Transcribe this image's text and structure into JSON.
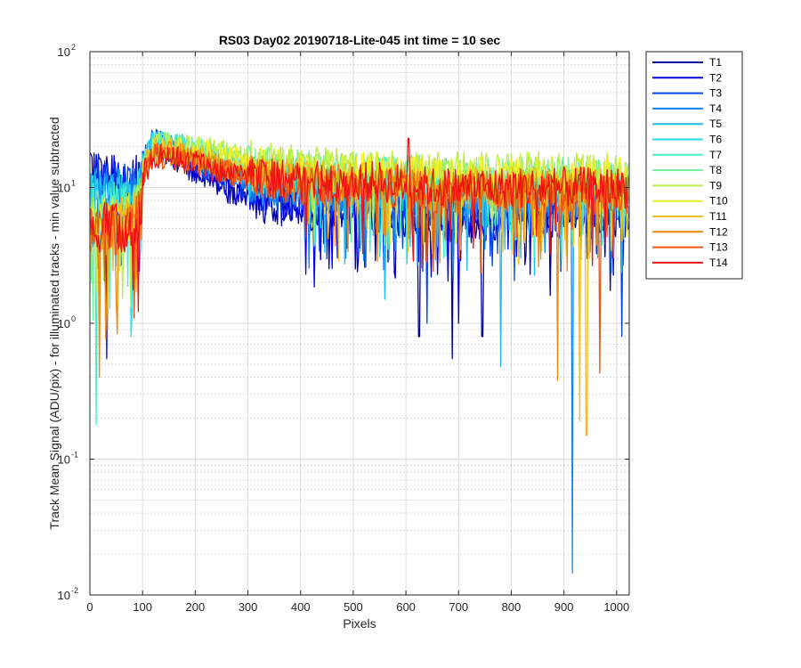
{
  "chart_data": {
    "type": "line",
    "title": "RS03 Day02 20190718-Lite-045 int time = 10 sec",
    "xlabel": "Pixels",
    "ylabel": "Track Mean Signal (ADU/pix) - for illuminated tracks - min value subtracted",
    "xscale": "linear",
    "yscale": "log",
    "xlim": [
      0,
      1024
    ],
    "ylim": [
      0.01,
      100
    ],
    "xticks": [
      0,
      100,
      200,
      300,
      400,
      500,
      600,
      700,
      800,
      900,
      1000
    ],
    "xtick_labels": [
      "0",
      "100",
      "200",
      "300",
      "400",
      "500",
      "600",
      "700",
      "800",
      "900",
      "1000"
    ],
    "ytick_labels": [
      {
        "base": "10",
        "exp": "-2"
      },
      {
        "base": "10",
        "exp": "-1"
      },
      {
        "base": "10",
        "exp": "0"
      },
      {
        "base": "10",
        "exp": "1"
      },
      {
        "base": "10",
        "exp": "2"
      }
    ],
    "grid": "major and minor",
    "legend_position": "outside-right",
    "series": [
      {
        "name": "T1",
        "color": "#0000aa",
        "x": [
          0,
          25,
          50,
          75,
          99,
          100,
          120,
          150,
          200,
          250,
          300,
          350,
          400,
          450,
          500,
          550,
          600,
          650,
          700,
          750,
          800,
          850,
          900,
          950,
          1000,
          1023
        ],
        "y": [
          13,
          12,
          11,
          10,
          12,
          16,
          20,
          18,
          13,
          10,
          8,
          7.5,
          7,
          6.5,
          6.5,
          6.5,
          6,
          5.5,
          5.5,
          5.5,
          6,
          6,
          6,
          6,
          6,
          6
        ],
        "dips": [
          [
            625,
            0.8
          ],
          [
            688,
            0.55
          ],
          [
            745,
            0.8
          ]
        ]
      },
      {
        "name": "T2",
        "color": "#0000dd",
        "x": [
          0,
          25,
          50,
          75,
          99,
          100,
          120,
          150,
          200,
          250,
          300,
          350,
          400,
          450,
          500,
          550,
          600,
          650,
          700,
          750,
          800,
          850,
          900,
          950,
          1000,
          1023
        ],
        "y": [
          12,
          11.5,
          11,
          10,
          12,
          16,
          21,
          19,
          14,
          11,
          9,
          8,
          7.5,
          7,
          7,
          7,
          6.5,
          6,
          6,
          6,
          6.5,
          6.5,
          6.5,
          6.5,
          6.5,
          6.5
        ],
        "dips": [
          [
            32,
            0.55
          ],
          [
            700,
            1.0
          ]
        ]
      },
      {
        "name": "T3",
        "color": "#0044ee",
        "x": [
          0,
          25,
          50,
          75,
          99,
          100,
          120,
          150,
          200,
          250,
          300,
          350,
          400,
          450,
          500,
          550,
          600,
          650,
          700,
          750,
          800,
          850,
          900,
          950,
          1000,
          1023
        ],
        "y": [
          11,
          11,
          10,
          9.5,
          11,
          16,
          22,
          20,
          15,
          12,
          10,
          9,
          8.5,
          8,
          8,
          8,
          7.5,
          7,
          7,
          7,
          7.5,
          7.5,
          7.5,
          7.5,
          7.5,
          7.5
        ],
        "dips": [
          [
            640,
            1.0
          ],
          [
            1010,
            0.8
          ]
        ]
      },
      {
        "name": "T4",
        "color": "#1188ee",
        "x": [
          0,
          25,
          50,
          75,
          99,
          100,
          120,
          150,
          200,
          250,
          300,
          350,
          400,
          450,
          500,
          550,
          600,
          650,
          700,
          750,
          800,
          850,
          900,
          950,
          1000,
          1023
        ],
        "y": [
          10,
          10,
          9.5,
          9,
          10.5,
          16,
          22,
          21,
          16,
          13,
          11,
          10,
          9.5,
          9,
          9,
          9,
          8.5,
          8,
          8,
          8,
          8.5,
          8.5,
          8.5,
          8.5,
          8.5,
          8.5
        ],
        "dips": [
          [
            916,
            0.0145
          ]
        ]
      },
      {
        "name": "T5",
        "color": "#22bbee",
        "x": [
          0,
          25,
          50,
          75,
          99,
          100,
          120,
          150,
          200,
          250,
          300,
          350,
          400,
          450,
          500,
          550,
          600,
          650,
          700,
          750,
          800,
          850,
          900,
          950,
          1000,
          1023
        ],
        "y": [
          9,
          9,
          8.5,
          8,
          9.5,
          15,
          21,
          21,
          17,
          14,
          12,
          11,
          10.5,
          10,
          10,
          10,
          9.5,
          9,
          9,
          9,
          9,
          9,
          9,
          9,
          9,
          9
        ],
        "dips": [
          [
            780,
            0.48
          ],
          [
            560,
            1.5
          ]
        ]
      },
      {
        "name": "T6",
        "color": "#22ddee",
        "x": [
          0,
          25,
          50,
          75,
          99,
          100,
          120,
          150,
          200,
          250,
          300,
          350,
          400,
          450,
          500,
          550,
          600,
          650,
          700,
          750,
          800,
          850,
          900,
          950,
          1000,
          1023
        ],
        "y": [
          8,
          8,
          7.5,
          7.5,
          9,
          15,
          21,
          21,
          18,
          15,
          13,
          12,
          11.5,
          11,
          11,
          11,
          10.5,
          10,
          10,
          10,
          10,
          10,
          10,
          10,
          10,
          10
        ],
        "dips": [
          [
            78,
            0.8
          ]
        ]
      },
      {
        "name": "T7",
        "color": "#44eecc",
        "x": [
          0,
          25,
          50,
          75,
          99,
          100,
          120,
          150,
          200,
          250,
          300,
          350,
          400,
          450,
          500,
          550,
          600,
          650,
          700,
          750,
          800,
          850,
          900,
          950,
          1000,
          1023
        ],
        "y": [
          7,
          7,
          7,
          7,
          8.5,
          14,
          21,
          21,
          19,
          16,
          14,
          13,
          12.5,
          12,
          12,
          12,
          11.5,
          11,
          11,
          11,
          11,
          11,
          11,
          11,
          11,
          11
        ],
        "dips": [
          [
            12,
            0.18
          ]
        ]
      },
      {
        "name": "T8",
        "color": "#77ee99",
        "x": [
          0,
          25,
          50,
          75,
          99,
          100,
          120,
          150,
          200,
          250,
          300,
          350,
          400,
          450,
          500,
          550,
          600,
          650,
          700,
          750,
          800,
          850,
          900,
          950,
          1000,
          1023
        ],
        "y": [
          6.5,
          6.5,
          6.5,
          6.5,
          8,
          14,
          21,
          21,
          19,
          17,
          15,
          14,
          13.5,
          13,
          13,
          13,
          12.5,
          12,
          12,
          12,
          12,
          12,
          12,
          12,
          12,
          12
        ],
        "dips": []
      },
      {
        "name": "T9",
        "color": "#bbee44",
        "x": [
          0,
          25,
          50,
          75,
          99,
          100,
          120,
          150,
          200,
          250,
          300,
          350,
          400,
          450,
          500,
          550,
          600,
          650,
          700,
          750,
          800,
          850,
          900,
          950,
          1000,
          1023
        ],
        "y": [
          6,
          6,
          6,
          6,
          7.5,
          13,
          20,
          21,
          20,
          18,
          16,
          15,
          14.5,
          14,
          14,
          14,
          13.5,
          13,
          13,
          13,
          13,
          13,
          13,
          13,
          13,
          13
        ],
        "dips": []
      },
      {
        "name": "T10",
        "color": "#eeee22",
        "x": [
          0,
          25,
          50,
          75,
          99,
          100,
          120,
          150,
          200,
          250,
          300,
          350,
          400,
          450,
          500,
          550,
          600,
          650,
          700,
          750,
          800,
          850,
          900,
          950,
          1000,
          1023
        ],
        "y": [
          5.5,
          5.5,
          5.5,
          5.5,
          7,
          13,
          20,
          20,
          19,
          17,
          15,
          14,
          13.5,
          13,
          13,
          13,
          12.5,
          12,
          12,
          12,
          12,
          12,
          12,
          12,
          12,
          12
        ],
        "dips": []
      },
      {
        "name": "T11",
        "color": "#eebb22",
        "x": [
          0,
          25,
          50,
          75,
          99,
          100,
          120,
          150,
          200,
          250,
          300,
          350,
          400,
          450,
          500,
          550,
          600,
          650,
          700,
          750,
          800,
          850,
          900,
          950,
          1000,
          1023
        ],
        "y": [
          5.5,
          5.5,
          5.5,
          5.5,
          7,
          13,
          19,
          19,
          17,
          15,
          13,
          12,
          11.5,
          11,
          11,
          11,
          10.5,
          10,
          10,
          10,
          10,
          10,
          10,
          10,
          10,
          10
        ],
        "dips": [
          [
            930,
            0.19
          ],
          [
            943,
            0.15
          ]
        ]
      },
      {
        "name": "T12",
        "color": "#ee8811",
        "x": [
          0,
          25,
          50,
          75,
          99,
          100,
          120,
          150,
          200,
          250,
          300,
          350,
          400,
          450,
          500,
          550,
          600,
          650,
          700,
          750,
          800,
          850,
          900,
          950,
          1000,
          1023
        ],
        "y": [
          5,
          5,
          5,
          5,
          6.5,
          12,
          18,
          18,
          16,
          14,
          12.5,
          11.5,
          11,
          10.5,
          10.5,
          10.5,
          10,
          9.5,
          9.5,
          9.5,
          9.5,
          9.5,
          9.5,
          9.5,
          9.5,
          9.5
        ],
        "dips": [
          [
            888,
            0.38
          ],
          [
            18,
            0.4
          ]
        ]
      },
      {
        "name": "T13",
        "color": "#ee5511",
        "x": [
          0,
          25,
          50,
          75,
          99,
          100,
          120,
          150,
          200,
          250,
          300,
          350,
          400,
          450,
          500,
          550,
          600,
          650,
          700,
          750,
          800,
          850,
          900,
          950,
          1000,
          1023
        ],
        "y": [
          5,
          5,
          5,
          5,
          6.5,
          12,
          17,
          17,
          15,
          13,
          12,
          11,
          10.5,
          10,
          10,
          10,
          9.5,
          9,
          9,
          9,
          9,
          9,
          9,
          9,
          9,
          9
        ],
        "dips": [
          [
            968,
            0.43
          ]
        ]
      },
      {
        "name": "T14",
        "color": "#ee1111",
        "x": [
          0,
          25,
          50,
          75,
          99,
          100,
          120,
          150,
          200,
          250,
          300,
          350,
          400,
          450,
          500,
          550,
          600,
          650,
          700,
          750,
          800,
          850,
          900,
          950,
          1000,
          1023
        ],
        "y": [
          5,
          5,
          5,
          5,
          6.5,
          12,
          17,
          17,
          15,
          13,
          12,
          11.5,
          11,
          11,
          11,
          11,
          10.5,
          10,
          10,
          10,
          10,
          10,
          10,
          10,
          10,
          10
        ],
        "dips": [
          [
            605,
            23
          ]
        ]
      }
    ]
  }
}
